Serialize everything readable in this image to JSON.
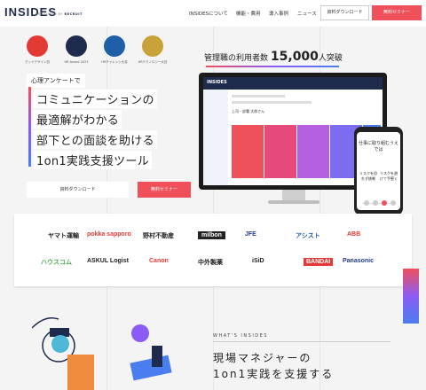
{
  "header": {
    "logo": "INSIDES",
    "logo_sub_prefix": "PRODUCED BY",
    "logo_sub_brand": "RECRUIT",
    "nav": [
      "INSIDESについて",
      "機能・費用",
      "導入事例",
      "ニュース"
    ],
    "download_label": "資料ダウンロード",
    "seminar_label": "無料セミナー"
  },
  "awards": [
    {
      "label": "グッドデザイン賞",
      "color": "#e53935"
    },
    {
      "label": "HR Award 2023",
      "color": "#1f2b4d"
    },
    {
      "label": "HRチャレンジ大賞",
      "color": "#1f5fa8"
    },
    {
      "label": "HRテクノロジー大賞",
      "color": "#c9a23a"
    }
  ],
  "hero": {
    "survey_label": "心理アンケートで",
    "lines": [
      "コミュニケーションの",
      "最適解がわかる",
      "部下との面談を助ける",
      "1on1実践支援ツール"
    ],
    "cta_download": "資料ダウンロード",
    "cta_seminar": "無料セミナー"
  },
  "users": {
    "prefix": "管理職の利用者数",
    "number": "15,000",
    "suffix": "人突破"
  },
  "monitor": {
    "logo": "INSIDES",
    "subordinate": "上司・部署 太郎さん",
    "column_colors": [
      "#f0505a",
      "#e64a7a",
      "#b45ee0",
      "#7b6cf0",
      "#4a7df0"
    ]
  },
  "phone": {
    "question": "仕事に取り組むうえでは",
    "option_left": "リスクを恐れず挑戦",
    "option_right": "リスクを避けて手堅く"
  },
  "client_logos": [
    "ヤマト運輸",
    "pokka sapporo",
    "野村不動産",
    "milbon",
    "JFE",
    "アシスト",
    "ABB",
    "ハウスコム",
    "ASKUL Logist",
    "Canon",
    "中外製薬",
    "iSiD",
    "BANDAI",
    "Panasonic"
  ],
  "about": {
    "eyebrow": "WHAT'S INSIDES",
    "title_line1": "現場マネジャーの",
    "title_line2": "1on1実践を支援する"
  }
}
